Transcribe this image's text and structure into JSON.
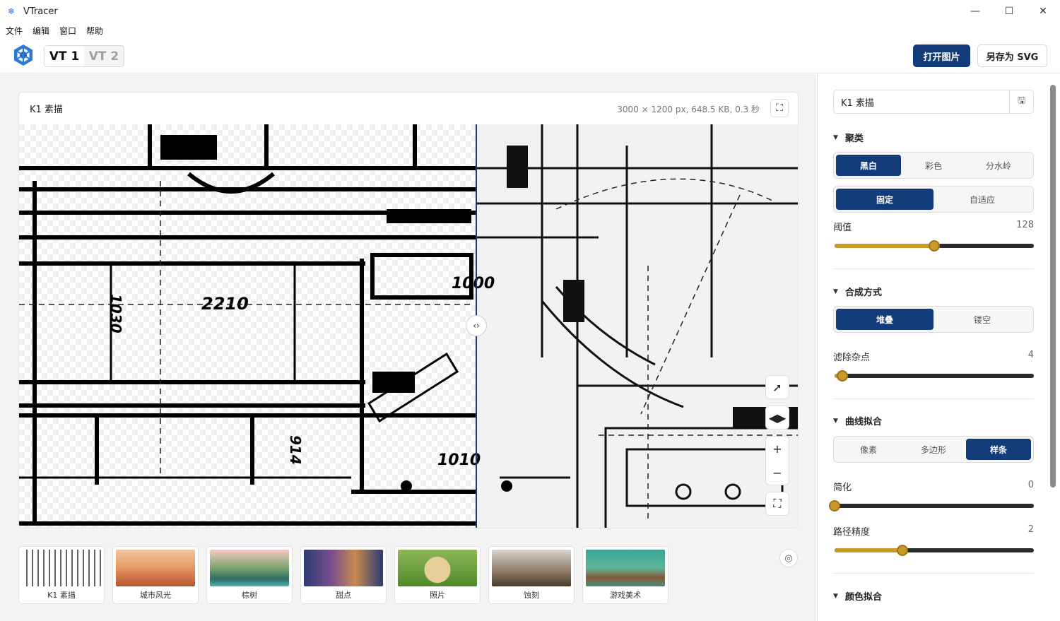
{
  "window": {
    "title": "VTracer",
    "minimize": "—",
    "maximize": "☐",
    "close": "✕"
  },
  "menu": [
    "文件",
    "编辑",
    "窗口",
    "帮助"
  ],
  "toolbar": {
    "vt1": "VT 1",
    "vt2": "VT 2",
    "open": "打开图片",
    "save": "另存为 SVG"
  },
  "viewer": {
    "title": "K1 素描",
    "meta": "3000 × 1200 px, 648.5 KB, 0.3 秒"
  },
  "thumbnails": [
    "K1 素描",
    "城市风光",
    "棕树",
    "甜点",
    "照片",
    "蚀刻",
    "游戏美术"
  ],
  "panel": {
    "preset": "K1 素描",
    "clustering": {
      "title": "聚类",
      "modes": [
        "黑白",
        "彩色",
        "分水岭"
      ],
      "active_mode": 0,
      "types": [
        "固定",
        "自适应"
      ],
      "active_type": 0
    },
    "threshold": {
      "label": "阈值",
      "value": "128",
      "level": 0.5
    },
    "compose": {
      "title": "合成方式",
      "options": [
        "堆叠",
        "镂空"
      ],
      "active": 0
    },
    "filter_speckle": {
      "label": "滤除杂点",
      "value": "4",
      "level": 0.04
    },
    "curve": {
      "title": "曲线拟合",
      "options": [
        "像素",
        "多边形",
        "样条"
      ],
      "active": 2
    },
    "simplify": {
      "label": "简化",
      "value": "0",
      "level": 0.0
    },
    "path_precision": {
      "label": "路径精度",
      "value": "2",
      "level": 0.34
    },
    "color_fit": {
      "title": "颜色拟合"
    }
  },
  "colors": {
    "accent": "#123b7a",
    "slider": "#c99a2a"
  }
}
